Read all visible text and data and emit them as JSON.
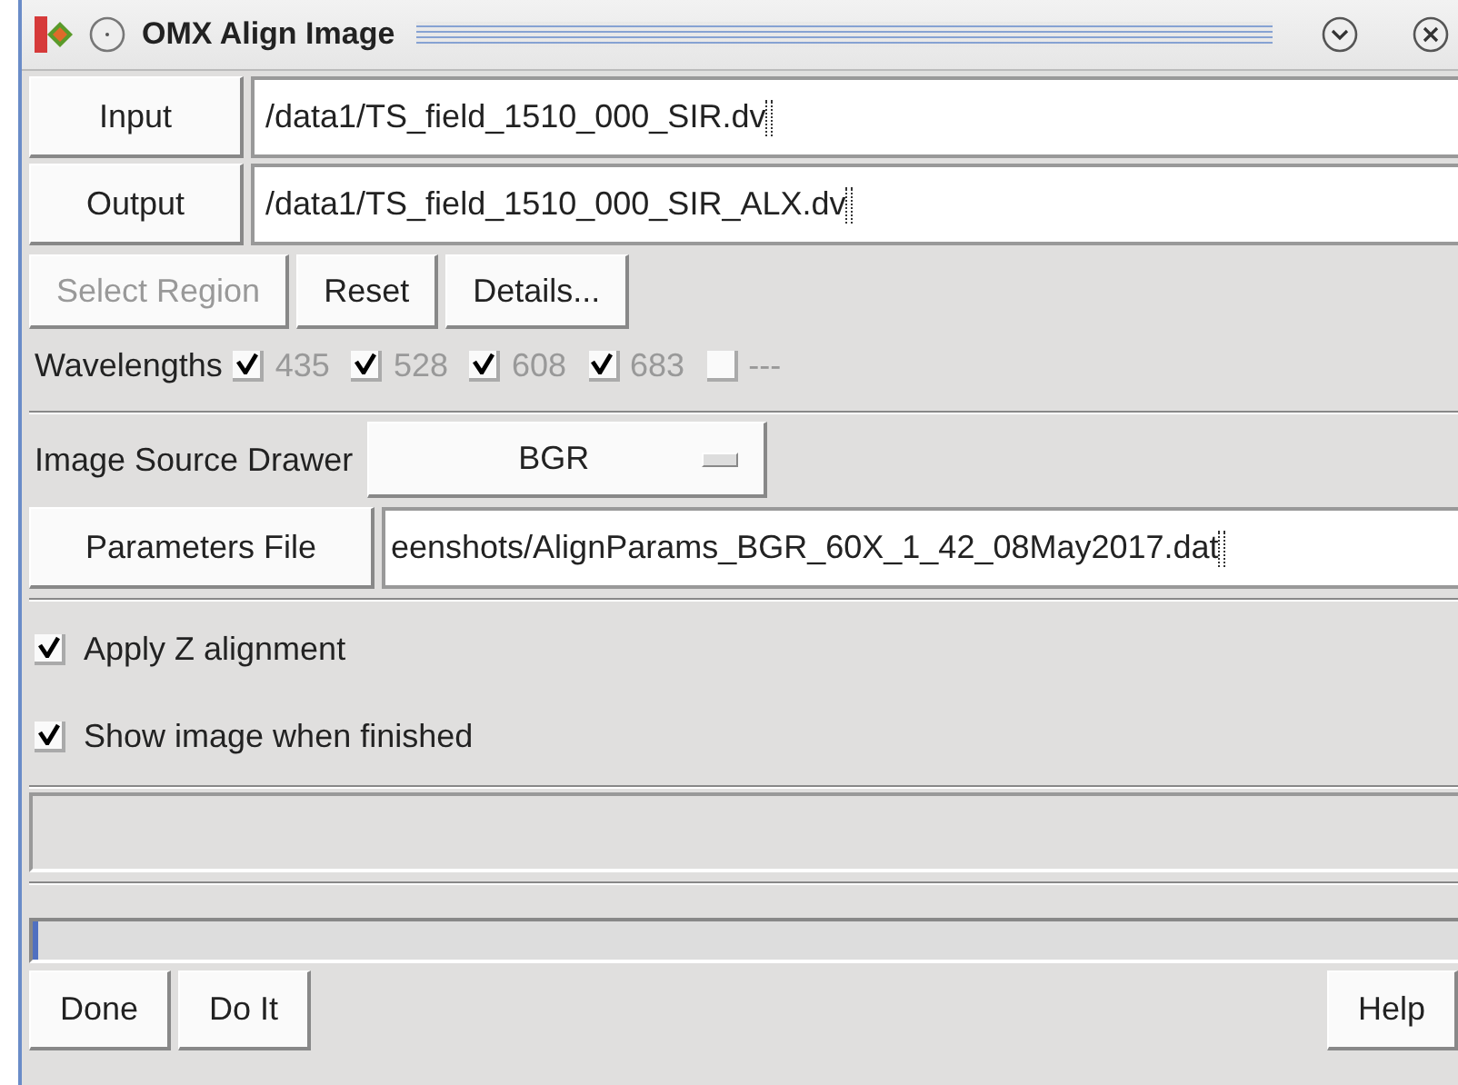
{
  "window": {
    "title": "OMX Align Image"
  },
  "file_rows": [
    {
      "button": "Input",
      "value": "/data1/TS_field_1510_000_SIR.dv"
    },
    {
      "button": "Output",
      "value": "/data1/TS_field_1510_000_SIR_ALX.dv"
    }
  ],
  "action_buttons": [
    {
      "label": "Select Region",
      "disabled": true
    },
    {
      "label": "Reset",
      "disabled": false
    },
    {
      "label": "Details...",
      "disabled": false
    }
  ],
  "wavelengths": {
    "label": "Wavelengths",
    "items": [
      {
        "label": "435",
        "checked": true,
        "disabled": true
      },
      {
        "label": "528",
        "checked": true,
        "disabled": true
      },
      {
        "label": "608",
        "checked": true,
        "disabled": true
      },
      {
        "label": "683",
        "checked": true,
        "disabled": true
      },
      {
        "label": "---",
        "checked": false,
        "disabled": true
      }
    ]
  },
  "image_source": {
    "label": "Image Source Drawer",
    "value": "BGR"
  },
  "parameters_file": {
    "button": "Parameters File",
    "value": "eenshots/AlignParams_BGR_60X_1_42_08May2017.dat"
  },
  "options": [
    {
      "label": "Apply Z alignment",
      "checked": true
    },
    {
      "label": "Show image when finished",
      "checked": true
    }
  ],
  "progress": {
    "level": 0.004
  },
  "bottom_left_buttons": [
    "Done",
    "Do It"
  ],
  "bottom_right_buttons": [
    "Help"
  ]
}
